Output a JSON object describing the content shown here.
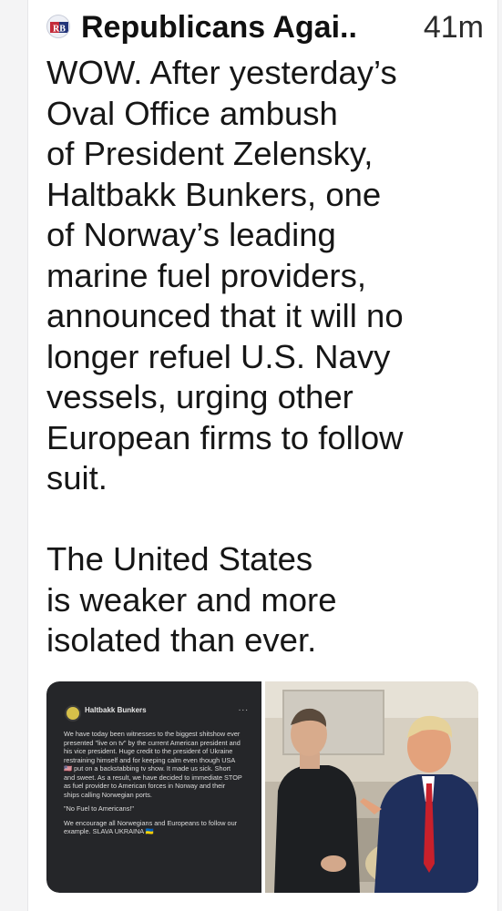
{
  "post": {
    "author": "Republicans Agai..",
    "avatar_initials": "RB",
    "time": "41m",
    "paragraph1_lines": [
      "WOW. After yesterday’s",
      "Oval Office ambush",
      "of President Zelensky,",
      "Haltbakk Bunkers, one",
      "of Norway’s leading",
      "marine fuel providers,",
      "announced that it will no",
      "longer refuel U.S. Navy",
      "vessels, urging other",
      "European firms to follow",
      "suit."
    ],
    "paragraph2_lines": [
      "The United States",
      "is weaker and more",
      "isolated than ever."
    ]
  },
  "embedded_post": {
    "page_name": "Haltbakk Bunkers",
    "menu": "...",
    "paragraph1": "We have today been witnesses to the biggest shitshow ever presented \"live on tv\" by the current American president and his vice president. Huge credit to the president of Ukraine restraining himself and for keeping calm even though USA 🇺🇸 put on a backstabbing tv show. It made us sick. Short and sweet. As a result, we have decided to immediate STOP as fuel provider to American forces in Norway and their ships calling Norwegian ports.",
    "paragraph2": "\"No Fuel to Americans!\"",
    "paragraph3": "We encourage all Norwegians and Europeans to follow our example. SLAVA UKRAINA 🇺🇦"
  },
  "colors": {
    "text": "#161616",
    "dark_card": "#252629",
    "suit_navy": "#1f2f5c",
    "tie_red": "#c8202b"
  }
}
